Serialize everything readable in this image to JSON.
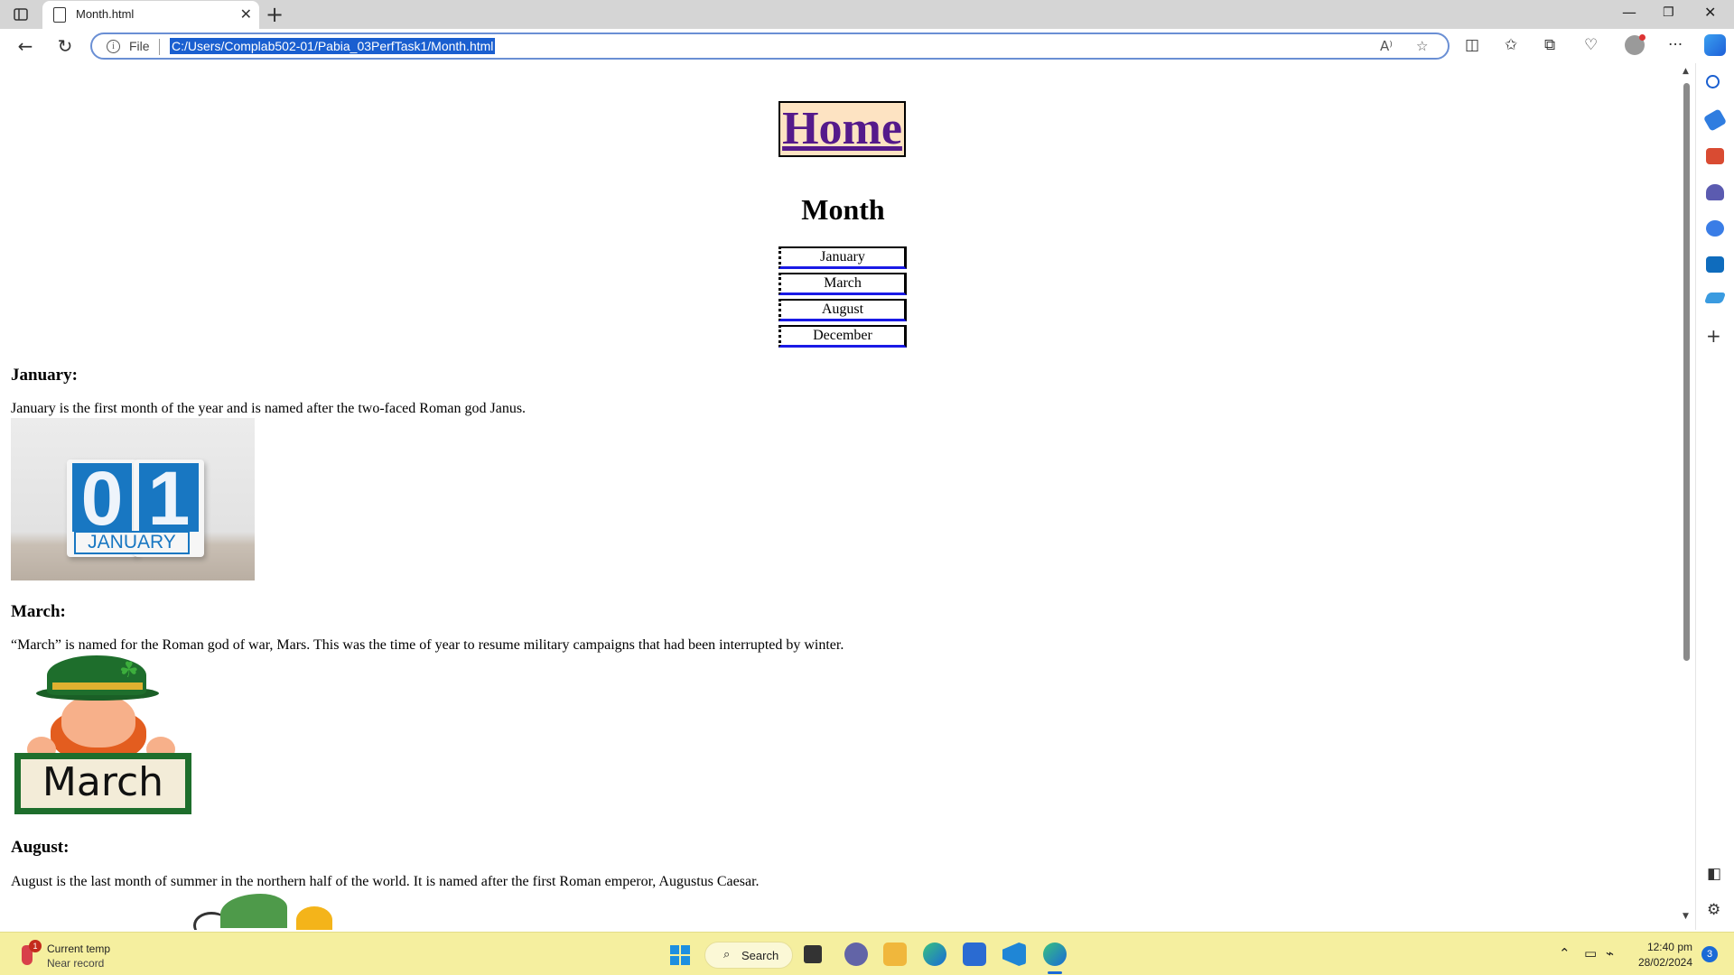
{
  "browser": {
    "tab_title": "Month.html",
    "file_label": "File",
    "url": "C:/Users/Complab502-01/Pabia_03PerfTask1/Month.html"
  },
  "page": {
    "home_link": "Home",
    "title": "Month",
    "nav_buttons": [
      "January",
      "March",
      "August",
      "December"
    ],
    "sections": [
      {
        "heading": "January:",
        "text": "January is the first month of the year and is named after the two-faced Roman god Janus.",
        "image_text": [
          "0",
          "1",
          "JANUARY"
        ]
      },
      {
        "heading": "March:",
        "text": "“March” is named for the Roman god of war, Mars. This was the time of year to resume military campaigns that had been interrupted by winter.",
        "image_text": "March"
      },
      {
        "heading": "August:",
        "text": "August is the last month of summer in the northern half of the world. It is named after the first Roman emperor, Augustus Caesar."
      }
    ]
  },
  "taskbar": {
    "weather_title": "Current temp",
    "weather_sub": "Near record",
    "weather_badge": "1",
    "search_label": "Search",
    "time": "12:40 pm",
    "date": "28/02/2024",
    "notification_count": "3"
  },
  "colors": {
    "link_visited": "#551a8b",
    "home_bg": "#fde3c2",
    "taskbar_bg": "#f5ef9f",
    "url_highlight": "#1a5fd0",
    "omnibox_border": "#6a8fd4"
  }
}
